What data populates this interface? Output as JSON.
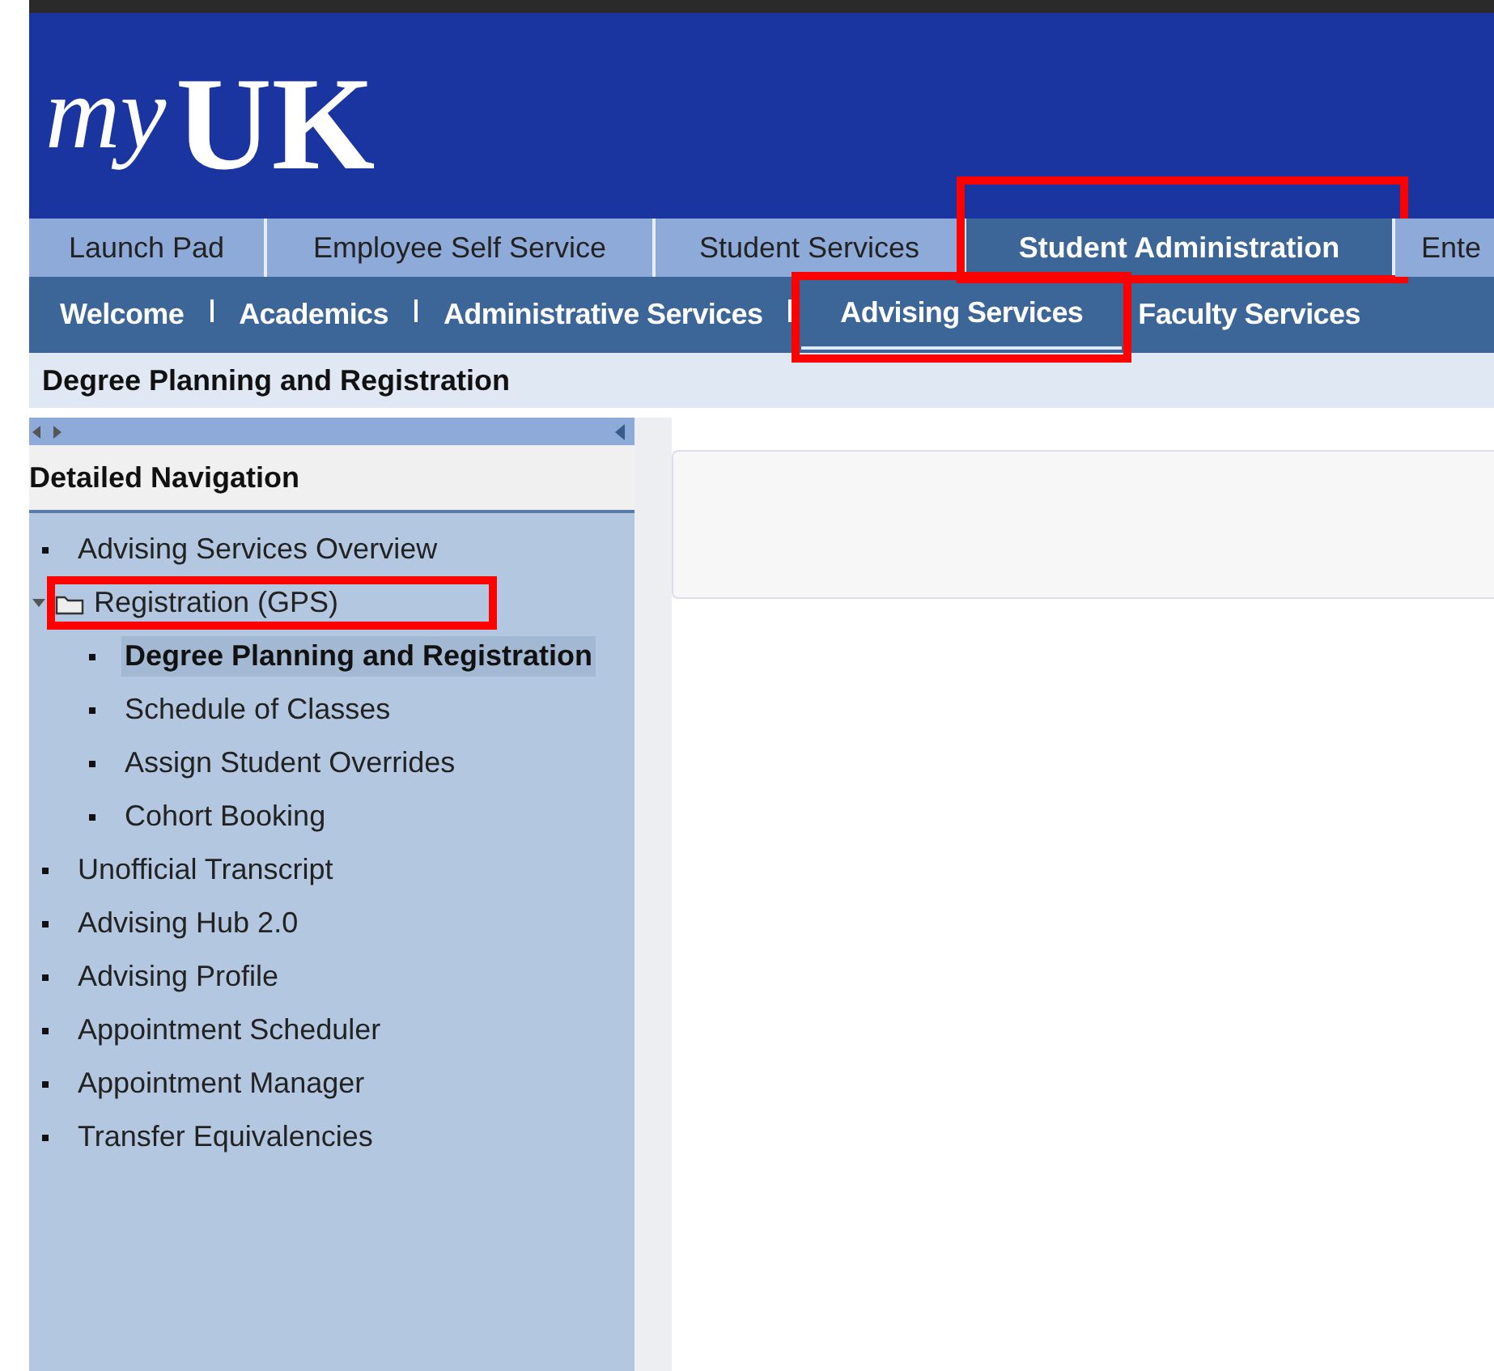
{
  "logo": {
    "script": "my",
    "mark": "UK"
  },
  "tabs": [
    {
      "label": "Launch Pad",
      "selected": false,
      "highlighted": false
    },
    {
      "label": "Employee Self Service",
      "selected": false,
      "highlighted": false
    },
    {
      "label": "Student Services",
      "selected": false,
      "highlighted": false
    },
    {
      "label": "Student Administration",
      "selected": true,
      "highlighted": true
    },
    {
      "label": "Ente",
      "selected": false,
      "highlighted": false
    }
  ],
  "subnav": [
    {
      "label": "Welcome",
      "selected": false,
      "highlighted": false
    },
    {
      "label": "Academics",
      "selected": false,
      "highlighted": false
    },
    {
      "label": "Administrative Services",
      "selected": false,
      "highlighted": false
    },
    {
      "label": "Advising Services",
      "selected": true,
      "highlighted": true
    },
    {
      "label": "Faculty Services",
      "selected": false,
      "highlighted": false
    }
  ],
  "breadcrumb": "Degree Planning and Registration",
  "sidebar": {
    "title": "Detailed Navigation",
    "items": [
      {
        "label": "Advising Services Overview",
        "selected": false,
        "highlighted": false
      },
      {
        "label": "Registration (GPS)",
        "selected": false,
        "highlighted": true,
        "expanded": true,
        "children": [
          {
            "label": "Degree Planning and Registration",
            "selected": true,
            "highlighted": false
          },
          {
            "label": "Schedule of Classes",
            "selected": false,
            "highlighted": false
          },
          {
            "label": "Assign Student Overrides",
            "selected": false,
            "highlighted": false
          },
          {
            "label": "Cohort Booking",
            "selected": false,
            "highlighted": false
          }
        ]
      },
      {
        "label": "Unofficial Transcript",
        "selected": false,
        "highlighted": false
      },
      {
        "label": "Advising Hub 2.0",
        "selected": false,
        "highlighted": false
      },
      {
        "label": "Advising Profile",
        "selected": false,
        "highlighted": false
      },
      {
        "label": "Appointment Scheduler",
        "selected": false,
        "highlighted": false
      },
      {
        "label": "Appointment Manager",
        "selected": false,
        "highlighted": false
      },
      {
        "label": "Transfer Equivalencies",
        "selected": false,
        "highlighted": false
      }
    ]
  }
}
